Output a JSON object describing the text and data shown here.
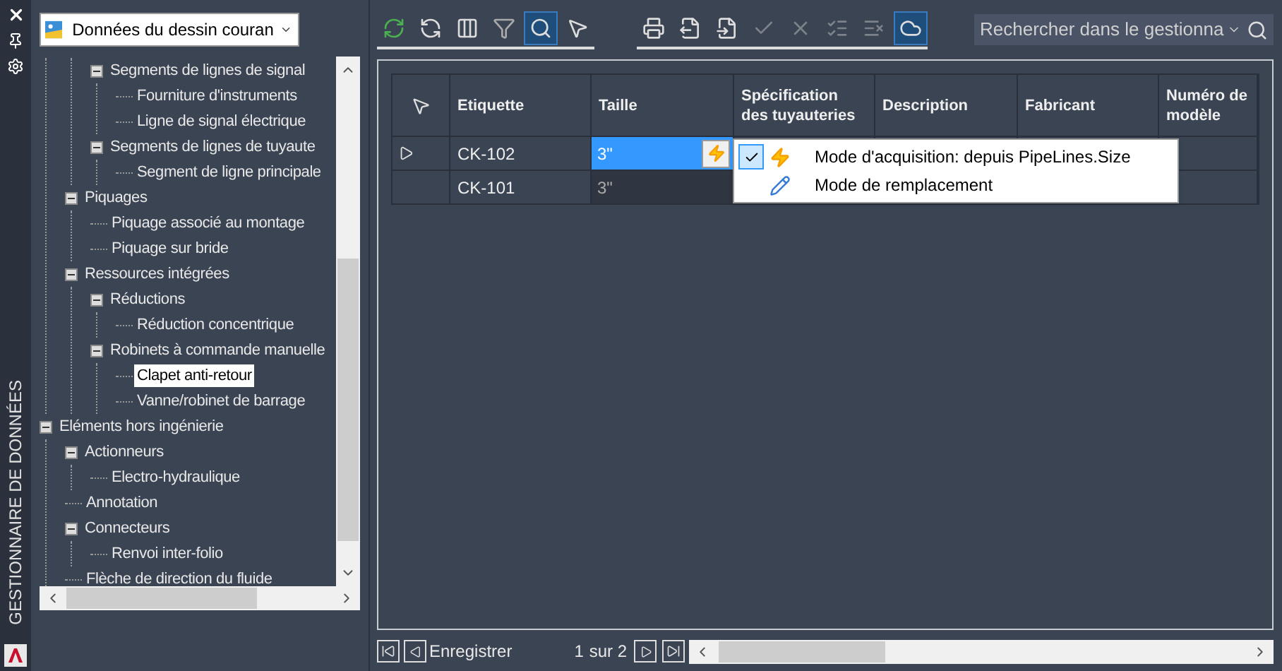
{
  "sidebar_strip": {
    "title": "GESTIONNAIRE DE DONNÉES"
  },
  "source_dropdown": {
    "value": "Données du dessin couran"
  },
  "tree": {
    "items": [
      {
        "children": [
          {
            "children": [
              {
                "label": "Segments de lignes de signal",
                "expanded": true,
                "selected": false,
                "children": [
                  {
                    "label": "Fourniture d'instruments",
                    "selected": false
                  },
                  {
                    "label": "Ligne de signal électrique",
                    "selected": false
                  }
                ]
              },
              {
                "label": "Segments de lignes de tuyaute",
                "expanded": true,
                "selected": false,
                "children": [
                  {
                    "label": "Segment de ligne principale",
                    "selected": false
                  }
                ]
              }
            ]
          },
          {
            "label": "Piquages",
            "expanded": true,
            "selected": false,
            "children": [
              {
                "label": "Piquage associé au montage",
                "selected": false
              },
              {
                "label": "Piquage sur bride",
                "selected": false
              }
            ]
          },
          {
            "label": "Ressources intégrées",
            "expanded": true,
            "selected": false,
            "children": [
              {
                "label": "Réductions",
                "expanded": true,
                "selected": false,
                "children": [
                  {
                    "label": "Réduction concentrique",
                    "selected": false
                  }
                ]
              },
              {
                "label": "Robinets à commande manuelle",
                "expanded": true,
                "selected": false,
                "children": [
                  {
                    "label": "Clapet anti-retour",
                    "selected": true
                  },
                  {
                    "label": "Vanne/robinet de barrage",
                    "selected": false
                  }
                ]
              }
            ]
          }
        ]
      },
      {
        "label": "Eléments hors ingénierie",
        "expanded": true,
        "selected": false,
        "children": [
          {
            "label": "Actionneurs",
            "expanded": true,
            "selected": false,
            "children": [
              {
                "label": "Electro-hydraulique",
                "selected": false
              }
            ]
          },
          {
            "label": "Annotation",
            "selected": false
          },
          {
            "label": "Connecteurs",
            "expanded": true,
            "selected": false,
            "children": [
              {
                "label": "Renvoi inter-folio",
                "selected": false
              }
            ]
          },
          {
            "label": "Flèche de direction du fluide",
            "selected": false
          }
        ]
      }
    ]
  },
  "toolbar": [
    {
      "kind": "refresh",
      "selected": false,
      "disabled": false
    },
    {
      "kind": "sync",
      "selected": false,
      "disabled": false
    },
    {
      "kind": "columns",
      "selected": false,
      "disabled": false
    },
    {
      "kind": "filter",
      "selected": false,
      "disabled": false
    },
    {
      "kind": "zoom",
      "selected": true,
      "disabled": false
    },
    {
      "kind": "pick",
      "selected": false,
      "disabled": false
    },
    {
      "kind": "print",
      "selected": false,
      "disabled": false
    },
    {
      "kind": "export",
      "selected": false,
      "disabled": false
    },
    {
      "kind": "import",
      "selected": false,
      "disabled": false
    },
    {
      "kind": "accept",
      "selected": false,
      "disabled": true
    },
    {
      "kind": "reject",
      "selected": false,
      "disabled": true
    },
    {
      "kind": "accept-all",
      "selected": false,
      "disabled": true
    },
    {
      "kind": "reject-all",
      "selected": false,
      "disabled": true
    },
    {
      "kind": "cloud",
      "selected": true,
      "disabled": false
    }
  ],
  "search": {
    "placeholder": "Rechercher dans le gestionna"
  },
  "table": {
    "columns": [
      "Etiquette",
      "Taille",
      "Spécification des tuyauteries",
      "Description",
      "Fabricant",
      "Numéro de modèle"
    ],
    "rows": [
      {
        "current": true,
        "cells": [
          "CK-102",
          "3\""
        ],
        "size_selected": true
      },
      {
        "current": false,
        "cells": [
          "CK-101",
          "3\""
        ],
        "size_selected": false
      }
    ]
  },
  "mode_menu": {
    "items": [
      {
        "kind": "lightning",
        "label": "Mode d'acquisition: depuis PipeLines.Size",
        "checked": true
      },
      {
        "kind": "pencil",
        "label": "Mode de remplacement",
        "checked": false
      }
    ]
  },
  "footer": {
    "label": "Enregistrer",
    "page": "1",
    "total": "sur 2"
  }
}
